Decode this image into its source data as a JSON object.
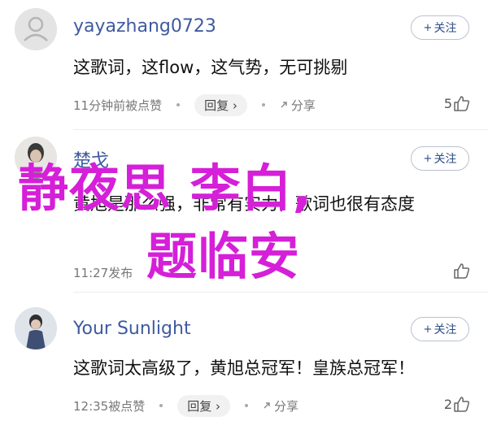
{
  "comments": [
    {
      "username": "yayazhang0723",
      "follow_label": "关注",
      "text": "这歌词，这flow，这气势，无可挑剔",
      "time_meta": "11分钟前被点赞",
      "reply_label": "回复",
      "share_label": "分享",
      "likes": "5"
    },
    {
      "username": "楚戈",
      "follow_label": "关注",
      "text": "黄旭是那么强，非常有实力，歌词也很有态度",
      "time_meta": "11:27发布",
      "reply_label": "",
      "share_label": "",
      "likes": ""
    },
    {
      "username": "Your Sunlight",
      "follow_label": "关注",
      "text": "这歌词太高级了，黄旭总冠军！皇族总冠军！",
      "time_meta": "12:35被点赞",
      "reply_label": "回复",
      "share_label": "分享",
      "likes": "2"
    }
  ],
  "overlay": {
    "line1": "静夜思 李白,",
    "line2": "题临安"
  },
  "colors": {
    "username": "#3f5aa0",
    "overlay": "#d51fd8",
    "follow_border": "#b9c2cf"
  }
}
